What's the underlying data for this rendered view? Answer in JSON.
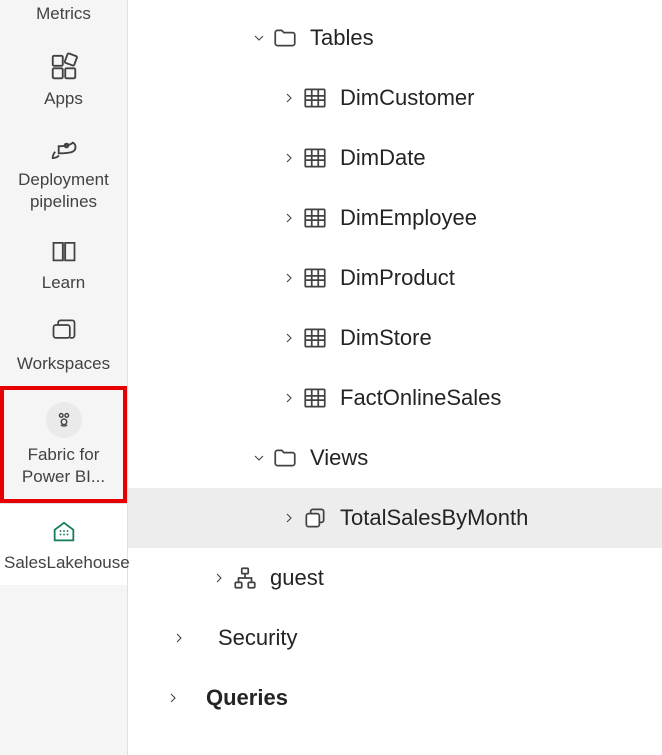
{
  "sidebar": {
    "items": [
      {
        "label": "Metrics",
        "icon": "metrics"
      },
      {
        "label": "Apps",
        "icon": "apps"
      },
      {
        "label": "Deployment pipelines",
        "icon": "rocket"
      },
      {
        "label": "Learn",
        "icon": "book"
      },
      {
        "label": "Workspaces",
        "icon": "workspaces"
      },
      {
        "label": "Fabric for Power BI...",
        "icon": "fabric",
        "highlighted": true
      },
      {
        "label": "SalesLakehouse",
        "icon": "lakehouse",
        "active": true
      }
    ]
  },
  "tree": {
    "tables": {
      "label": "Tables",
      "items": [
        "DimCustomer",
        "DimDate",
        "DimEmployee",
        "DimProduct",
        "DimStore",
        "FactOnlineSales"
      ]
    },
    "views": {
      "label": "Views",
      "items": [
        "TotalSalesByMonth"
      ]
    },
    "guest": {
      "label": "guest"
    },
    "security": {
      "label": "Security"
    },
    "queries": {
      "label": "Queries"
    }
  }
}
